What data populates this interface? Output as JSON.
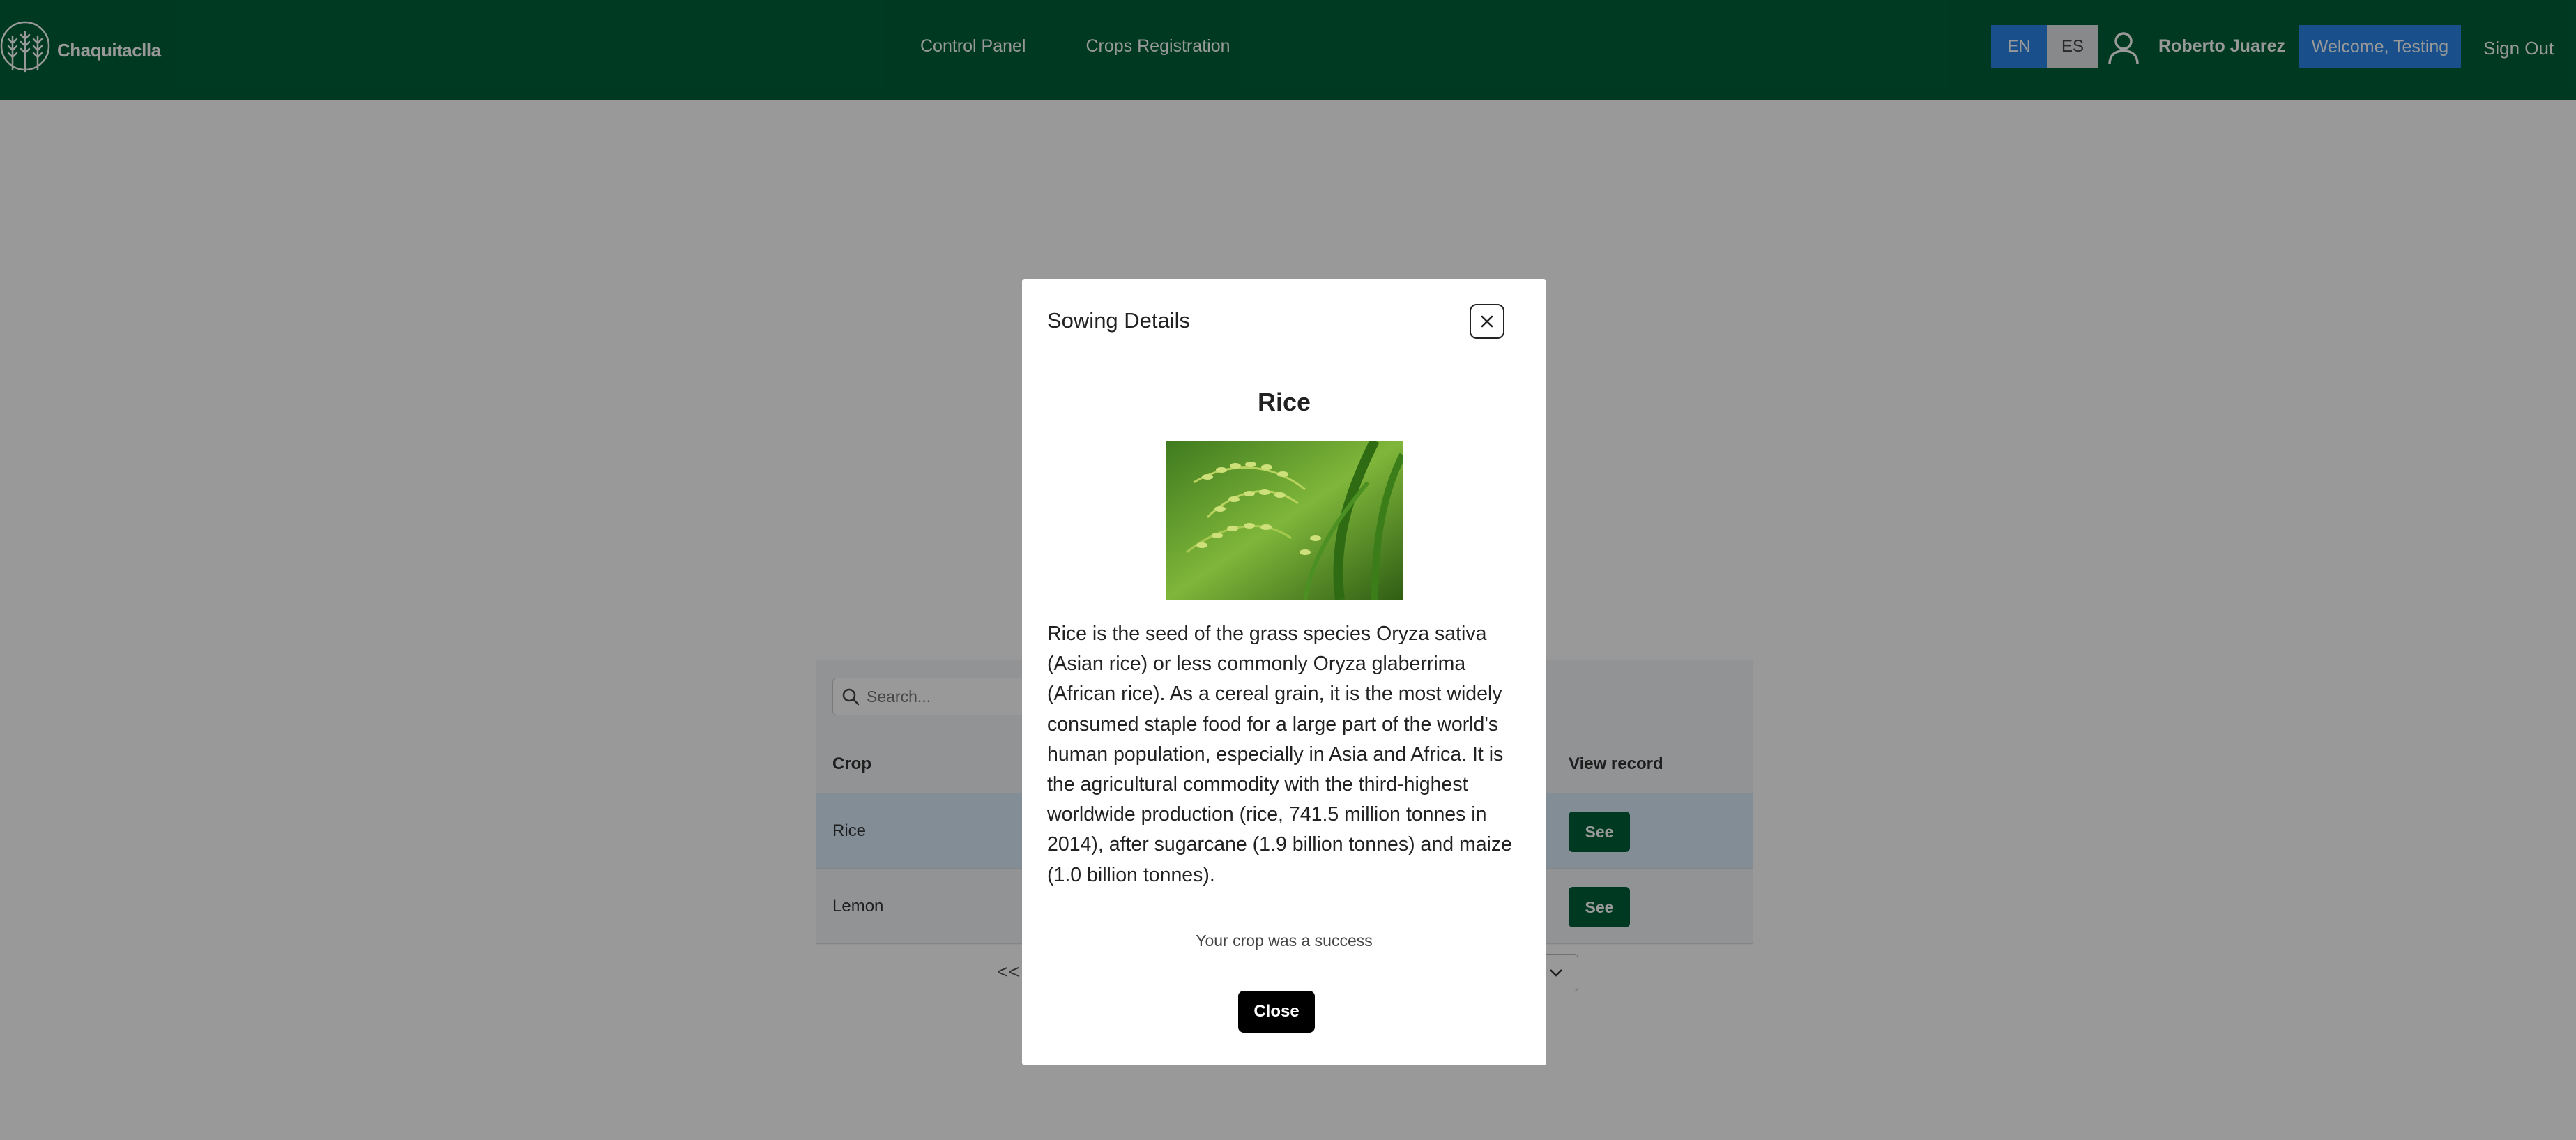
{
  "navbar": {
    "brand": "Chaquitaclla",
    "links": [
      "Control Panel",
      "Crops Registration"
    ],
    "lang_en": "EN",
    "lang_es": "ES",
    "user_name": "Roberto Juarez",
    "welcome": "Welcome, Testing",
    "sign_out": "Sign Out"
  },
  "table": {
    "search_placeholder": "Search...",
    "headers": {
      "crop": "Crop",
      "view": "View record"
    },
    "rows": [
      {
        "crop": "Rice",
        "action": "See"
      },
      {
        "crop": "Lemon",
        "action": "See"
      }
    ],
    "pager_prev": "<<"
  },
  "modal": {
    "title": "Sowing Details",
    "crop_name": "Rice",
    "description": "Rice is the seed of the grass species Oryza sativa (Asian rice) or less commonly Oryza glaberrima (African rice). As a cereal grain, it is the most widely consumed staple food for a large part of the world's human population, especially in Asia and Africa. It is the agricultural commodity with the third-highest worldwide production (rice, 741.5 million tonnes in 2014), after sugarcane (1.9 billion tonnes) and maize (1.0 billion tonnes).",
    "status": "Your crop was a success",
    "close_label": "Close"
  },
  "icons": {
    "logo": "wheat-logo-icon",
    "user": "user-icon",
    "search": "search-icon",
    "close": "close-icon",
    "select": "chevron-down-icon"
  },
  "colors": {
    "navbar": "#00603a",
    "accent_blue": "#2a86e8",
    "see_button": "#00603a",
    "selected_row": "#d9ecfb"
  }
}
